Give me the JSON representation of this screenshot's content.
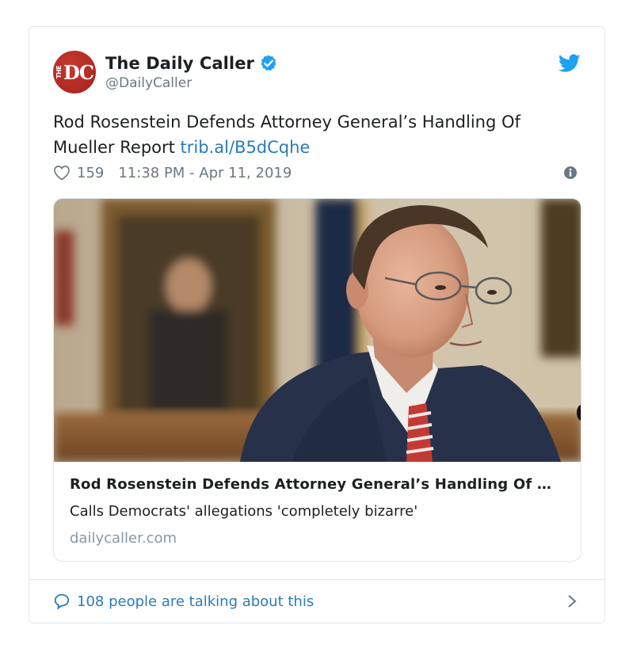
{
  "account": {
    "display_name": "The Daily Caller",
    "handle": "@DailyCaller",
    "avatar_text_small": "THE",
    "avatar_text_large": "DC",
    "verified": true
  },
  "tweet": {
    "text": "Rod Rosenstein Defends Attorney General’s Handling Of Mueller Report ",
    "link_text": "trib.al/B5dCqhe",
    "likes": "159",
    "timestamp": "11:38 PM - Apr 11, 2019"
  },
  "card": {
    "title": "Rod Rosenstein Defends Attorney General’s Handling Of Mueller Report",
    "description": "Calls Democrats' allegations 'completely bizarre'",
    "domain": "dailycaller.com"
  },
  "footer": {
    "talking_text": "108 people are talking about this"
  },
  "icons": {
    "verified": "verified-badge-icon",
    "bird": "twitter-bird-icon",
    "heart": "heart-icon",
    "info": "info-icon",
    "bubble": "speech-bubble-icon",
    "chevron": "chevron-right-icon"
  },
  "colors": {
    "link": "#2b7bb9",
    "verified": "#1da1f2",
    "avatar": "#b32b23",
    "muted": "#697882",
    "border": "#e1e8ed"
  }
}
